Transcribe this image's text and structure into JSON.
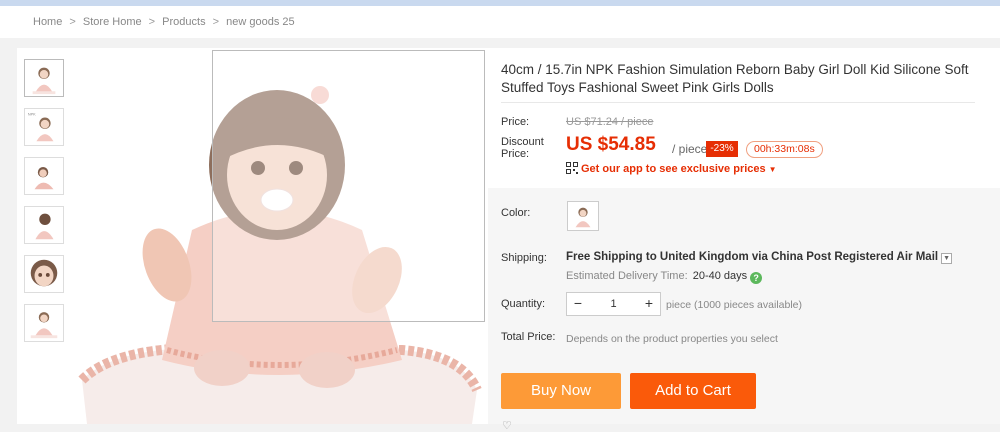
{
  "breadcrumb": [
    "Home",
    "Store Home",
    "Products",
    "new goods 25"
  ],
  "breadcrumb_sep": ">",
  "product": {
    "title": "40cm / 15.7in NPK Fashion Simulation Reborn Baby Girl Doll Kid Silicone Soft Stuffed Toys Fashional Sweet Pink Girls Dolls"
  },
  "price": {
    "label": "Price:",
    "original": "US $71.24 / piece",
    "discount_label": "Discount Price:",
    "discount": "US $54.85",
    "unit": "/ piece",
    "percent_off": "-23%",
    "countdown": "00h:33m:08s",
    "app_promo": "Get our app to see exclusive prices"
  },
  "color": {
    "label": "Color:"
  },
  "shipping": {
    "label": "Shipping:",
    "free_text": "Free Shipping to United Kingdom via China Post Registered Air Mail",
    "delivery_label": "Estimated Delivery Time:",
    "delivery_value": "20-40 days"
  },
  "quantity": {
    "label": "Quantity:",
    "value": "1",
    "minus": "−",
    "plus": "+",
    "availability": "piece (1000 pieces available)"
  },
  "total": {
    "label": "Total Price:",
    "note": "Depends on the product properties you select"
  },
  "actions": {
    "buy_now": "Buy Now",
    "add_to_cart": "Add to Cart"
  },
  "colors": {
    "accent": "#e62e04",
    "buy_now": "#fd9a37",
    "add_to_cart": "#fa5a0a"
  }
}
